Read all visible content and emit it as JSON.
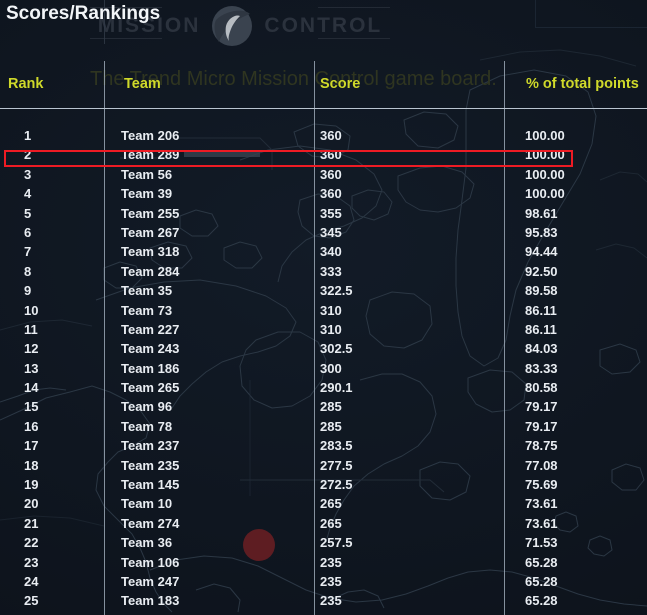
{
  "page": {
    "title": "Scores/Rankings",
    "background_tagline": "The Trend Micro Mission Control game board."
  },
  "branding": {
    "word_left": "MISSION",
    "word_right": "CONTROL",
    "logo_icon": "trend-micro-ball-icon"
  },
  "top_right_panel": {
    "label": "",
    "chip_icon": "status-chip-icon"
  },
  "colors": {
    "accent_header": "#cfd92a",
    "highlight_border": "#ee1b24",
    "background": "#101722",
    "text": "#e9edf2",
    "map_stroke": "#2b3744",
    "map_dot": "#5e1d22",
    "tagline": "#2f3520"
  },
  "table": {
    "columns": [
      "Rank",
      "Team",
      "Score",
      "% of total points"
    ],
    "highlighted_rank": 2,
    "rows": [
      {
        "rank": "1",
        "team": "Team 206",
        "score": "360",
        "pct": "100.00"
      },
      {
        "rank": "2",
        "team": "Team 289",
        "score": "360",
        "pct": "100.00"
      },
      {
        "rank": "3",
        "team": "Team 56",
        "score": "360",
        "pct": "100.00"
      },
      {
        "rank": "4",
        "team": "Team 39",
        "score": "360",
        "pct": "100.00"
      },
      {
        "rank": "5",
        "team": "Team 255",
        "score": "355",
        "pct": "98.61"
      },
      {
        "rank": "6",
        "team": "Team 267",
        "score": "345",
        "pct": "95.83"
      },
      {
        "rank": "7",
        "team": "Team 318",
        "score": "340",
        "pct": "94.44"
      },
      {
        "rank": "8",
        "team": "Team 284",
        "score": "333",
        "pct": "92.50"
      },
      {
        "rank": "9",
        "team": "Team 35",
        "score": "322.5",
        "pct": "89.58"
      },
      {
        "rank": "10",
        "team": "Team 73",
        "score": "310",
        "pct": "86.11"
      },
      {
        "rank": "11",
        "team": "Team 227",
        "score": "310",
        "pct": "86.11"
      },
      {
        "rank": "12",
        "team": "Team 243",
        "score": "302.5",
        "pct": "84.03"
      },
      {
        "rank": "13",
        "team": "Team 186",
        "score": "300",
        "pct": "83.33"
      },
      {
        "rank": "14",
        "team": "Team 265",
        "score": "290.1",
        "pct": "80.58"
      },
      {
        "rank": "15",
        "team": "Team 96",
        "score": "285",
        "pct": "79.17"
      },
      {
        "rank": "16",
        "team": "Team 78",
        "score": "285",
        "pct": "79.17"
      },
      {
        "rank": "17",
        "team": "Team 237",
        "score": "283.5",
        "pct": "78.75"
      },
      {
        "rank": "18",
        "team": "Team 235",
        "score": "277.5",
        "pct": "77.08"
      },
      {
        "rank": "19",
        "team": "Team 145",
        "score": "272.5",
        "pct": "75.69"
      },
      {
        "rank": "20",
        "team": "Team 10",
        "score": "265",
        "pct": "73.61"
      },
      {
        "rank": "21",
        "team": "Team 274",
        "score": "265",
        "pct": "73.61"
      },
      {
        "rank": "22",
        "team": "Team 36",
        "score": "257.5",
        "pct": "71.53"
      },
      {
        "rank": "23",
        "team": "Team 106",
        "score": "235",
        "pct": "65.28"
      },
      {
        "rank": "24",
        "team": "Team 247",
        "score": "235",
        "pct": "65.28"
      },
      {
        "rank": "25",
        "team": "Team 183",
        "score": "235",
        "pct": "65.28"
      }
    ]
  }
}
